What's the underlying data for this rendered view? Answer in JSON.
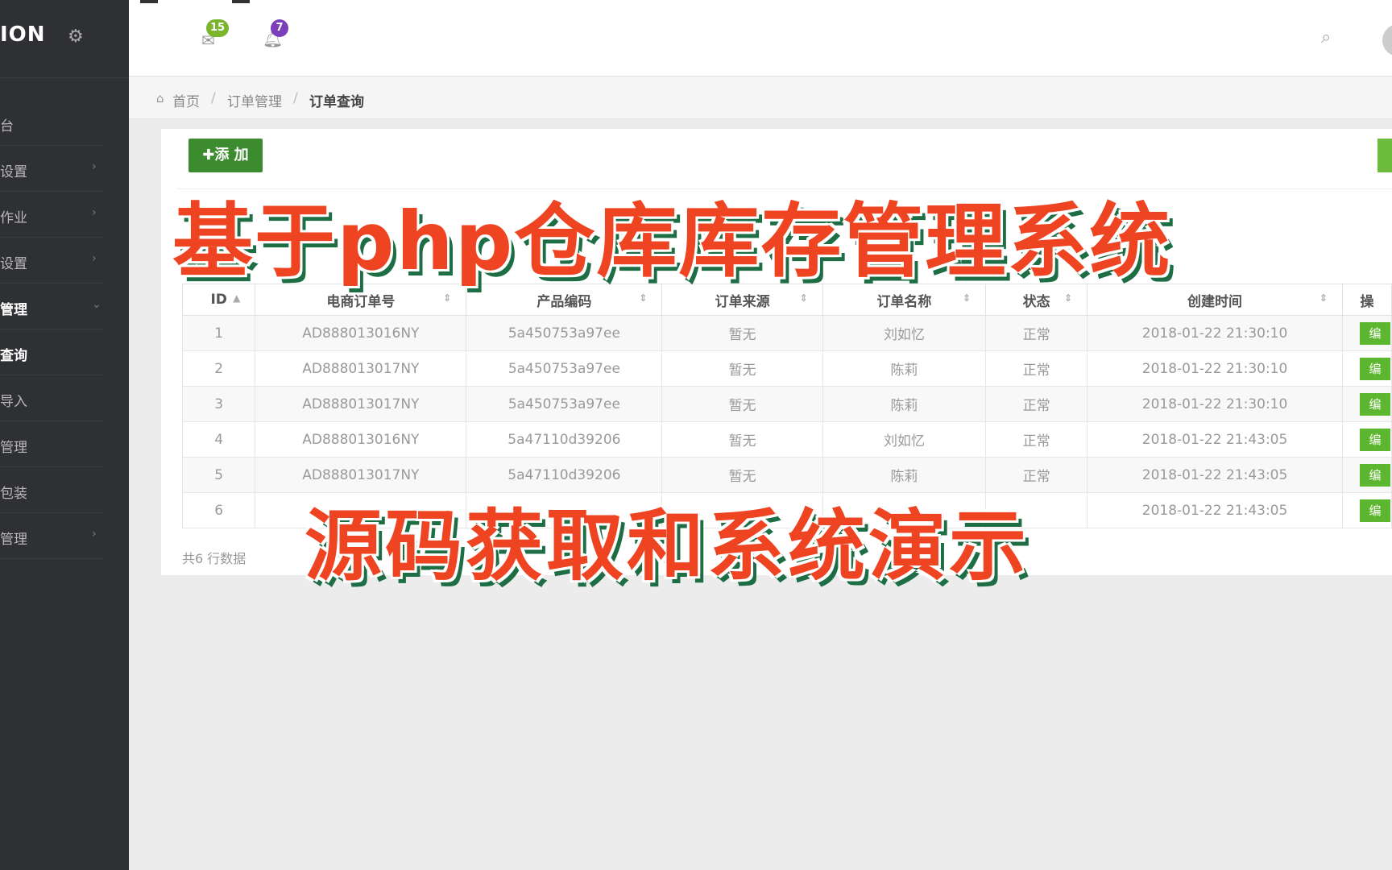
{
  "app": {
    "logo": "ION"
  },
  "sidebar": {
    "items": [
      {
        "label": "台",
        "arrow": ""
      },
      {
        "label": "设置",
        "arrow": "›"
      },
      {
        "label": "作业",
        "arrow": "›"
      },
      {
        "label": "设置",
        "arrow": "›"
      },
      {
        "label": "管理",
        "arrow": "⌄"
      },
      {
        "label": "查询",
        "arrow": ""
      },
      {
        "label": "导入",
        "arrow": ""
      },
      {
        "label": "管理",
        "arrow": ""
      },
      {
        "label": "包装",
        "arrow": ""
      },
      {
        "label": "管理",
        "arrow": "›"
      }
    ]
  },
  "header": {
    "mail_badge": "15",
    "notify_badge": "7"
  },
  "breadcrumb": {
    "home": "首页",
    "sep": "/",
    "order_mgmt": "订单管理",
    "current": "订单查询"
  },
  "toolbar": {
    "add_label": "✚添 加"
  },
  "table": {
    "columns": [
      "ID",
      "电商订单号",
      "产品编码",
      "订单来源",
      "订单名称",
      "状态",
      "创建时间",
      "操"
    ],
    "rows": [
      [
        "1",
        "AD888013016NY",
        "5a450753a97ee",
        "暂无",
        "刘如忆",
        "正常",
        "2018-01-22 21:30:10"
      ],
      [
        "2",
        "AD888013017NY",
        "5a450753a97ee",
        "暂无",
        "陈莉",
        "正常",
        "2018-01-22 21:30:10"
      ],
      [
        "3",
        "AD888013017NY",
        "5a450753a97ee",
        "暂无",
        "陈莉",
        "正常",
        "2018-01-22 21:30:10"
      ],
      [
        "4",
        "AD888013016NY",
        "5a47110d39206",
        "暂无",
        "刘如忆",
        "正常",
        "2018-01-22 21:43:05"
      ],
      [
        "5",
        "AD888013017NY",
        "5a47110d39206",
        "暂无",
        "陈莉",
        "正常",
        "2018-01-22 21:43:05"
      ],
      [
        "6",
        "",
        "",
        "",
        "",
        "",
        "2018-01-22 21:43:05"
      ]
    ],
    "edit_label": "编",
    "footer": "共6 行数据"
  },
  "overlay": {
    "title": "基于php仓库库存管理系统",
    "subtitle": "源码获取和系统演示"
  },
  "colors": {
    "sidebar_bg": "#2f3033",
    "primary_green": "#3d8b2f",
    "edit_green": "#5cb630",
    "overlay_red": "#ee4422",
    "overlay_shadow": "#1e6e45"
  }
}
